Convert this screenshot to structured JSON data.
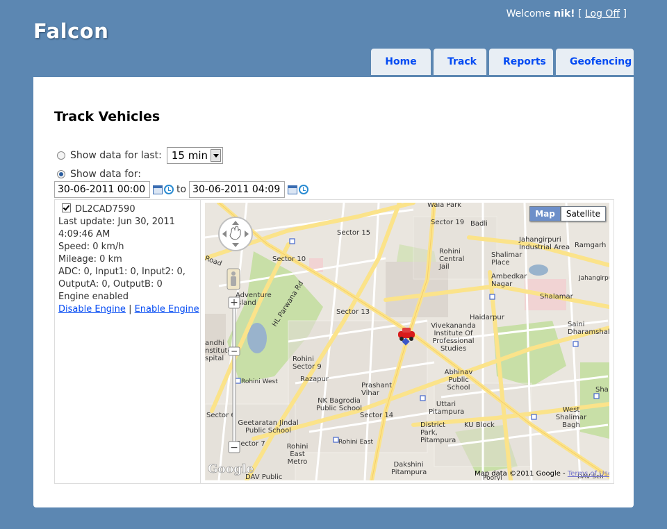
{
  "header": {
    "logo": "Falcon",
    "welcome": "Welcome",
    "user": "nik!",
    "bracket_open": "[",
    "logoff": "Log Off",
    "bracket_close": "]"
  },
  "menu": {
    "home": "Home",
    "track": "Track",
    "reports": "Reports",
    "geofencing": "Geofencing"
  },
  "page": {
    "title": "Track Vehicles",
    "show_last_label": "Show data for last:",
    "show_last_value": "15 min",
    "show_for_label": "Show data for:",
    "from": "30-06-2011 00:00",
    "to_label": "to",
    "to": "30-06-2011 04:09"
  },
  "vehicle": {
    "id": "DL2CAD7590",
    "last_update": "Last update: Jun 30, 2011",
    "last_update_time": "4:09:46 AM",
    "speed": "Speed: 0 km/h",
    "mileage": "Mileage: 0 km",
    "adc": "ADC: 0, Input1: 0, Input2: 0,",
    "outputs": "OutputA: 0, OutputB: 0",
    "engine": "Engine enabled",
    "disable": "Disable Engine",
    "sep": "|",
    "enable": "Enable Engine"
  },
  "map": {
    "type_map": "Map",
    "type_satellite": "Satellite",
    "attribution": "Map data ©2011 Google -",
    "terms": "Terms of Use",
    "google_logo": "Google",
    "labels": [
      "Wala Park",
      "Sector 15",
      "Sector 19",
      "Badli",
      "Jahangirpuri Industrial Area",
      "Ramgarh",
      "Rohini Central Jail",
      "Shalimar Place",
      "Sector 10",
      "Ambedkar Nagar",
      "Jahangirpuri",
      "Shalamar",
      "Adventure Island",
      "Sector 13",
      "Haidarpur",
      "Saini Dharamshala",
      "Vivekananda Institute Of Professional Studies",
      "HL Parwana Rd",
      "Rohini Sector 9",
      "Abhinav Public School",
      "Razapur",
      "Prashant Vihar",
      "Rohini West",
      "Sha",
      "NK Bagrodia Public School",
      "Uttari Pitampura",
      "West Shalimar Bagh",
      "Sector 14",
      "Sector 6",
      "Geetaratan Jindal Public School",
      "District Park, Pitampura",
      "KU Block",
      "Sector 7",
      "Rohini East Metro",
      "Rohini East",
      "Dakshini Pitampura",
      "DAV Public",
      "andhi nstitute spital",
      "Road",
      "Ro",
      "Pooryi",
      "DAV Sch"
    ]
  }
}
